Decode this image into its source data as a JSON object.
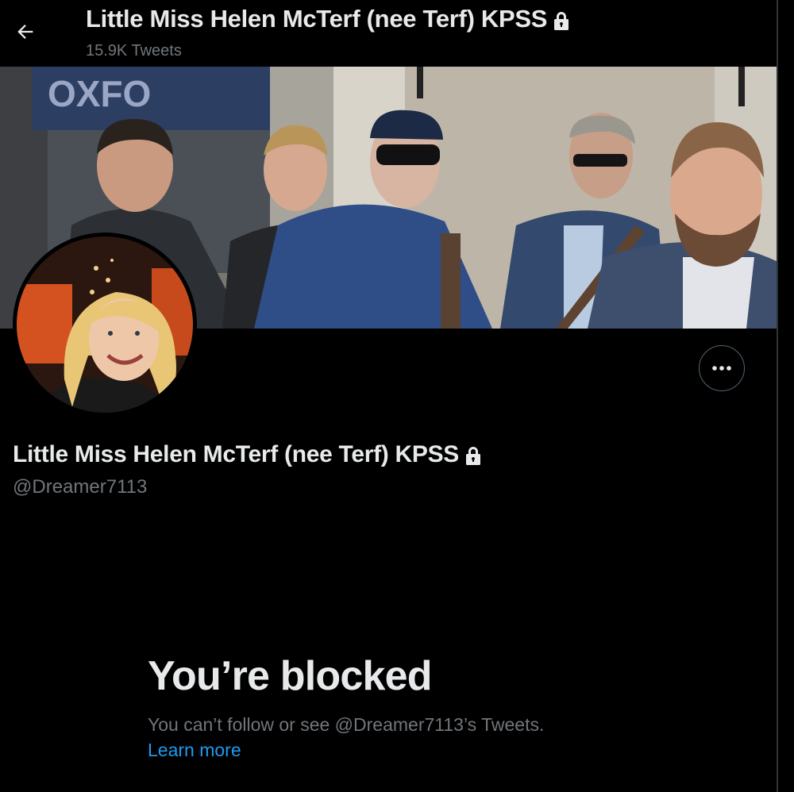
{
  "header": {
    "title": "Little Miss Helen McTerf (nee Terf) KPSS",
    "tweet_count": "15.9K Tweets"
  },
  "profile": {
    "display_name": "Little Miss Helen McTerf (nee Terf) KPSS",
    "handle": "@Dreamer7113",
    "protected": true,
    "banner_sign_text": "OXFO"
  },
  "blocked": {
    "title": "You’re blocked",
    "message": "You can’t follow or see @Dreamer7113’s Tweets.",
    "learn_more": "Learn more"
  },
  "colors": {
    "background": "#000000",
    "primary_text": "#e7e9ea",
    "secondary_text": "#71767b",
    "link": "#1d9bf0",
    "border": "#2f3336"
  },
  "icons": {
    "back": "arrow-left-icon",
    "lock": "lock-icon",
    "more": "more-horizontal-icon"
  }
}
